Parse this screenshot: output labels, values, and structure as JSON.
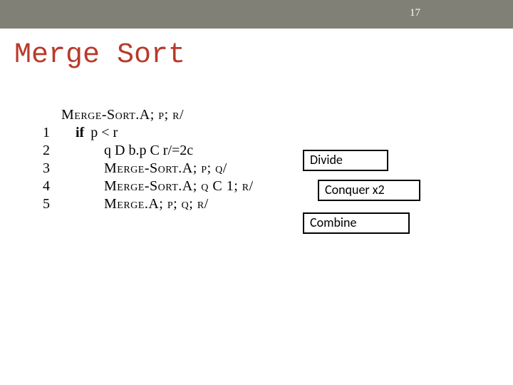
{
  "slide": {
    "number": "17",
    "title": "Merge Sort"
  },
  "code": {
    "header": "Merge-Sort.A; p; r/",
    "l1_kw": "if",
    "l1_rest": "p < r",
    "l2": "q D b.p C r/=2c",
    "l3": "Merge-Sort.A; p; q/",
    "l4": "Merge-Sort.A; q C 1; r/",
    "l5": "Merge.A; p; q; r/",
    "nums": {
      "n1": "1",
      "n2": "2",
      "n3": "3",
      "n4": "4",
      "n5": "5"
    }
  },
  "labels": {
    "divide": "Divide",
    "conquer": "Conquer x2",
    "combine": "Combine"
  }
}
